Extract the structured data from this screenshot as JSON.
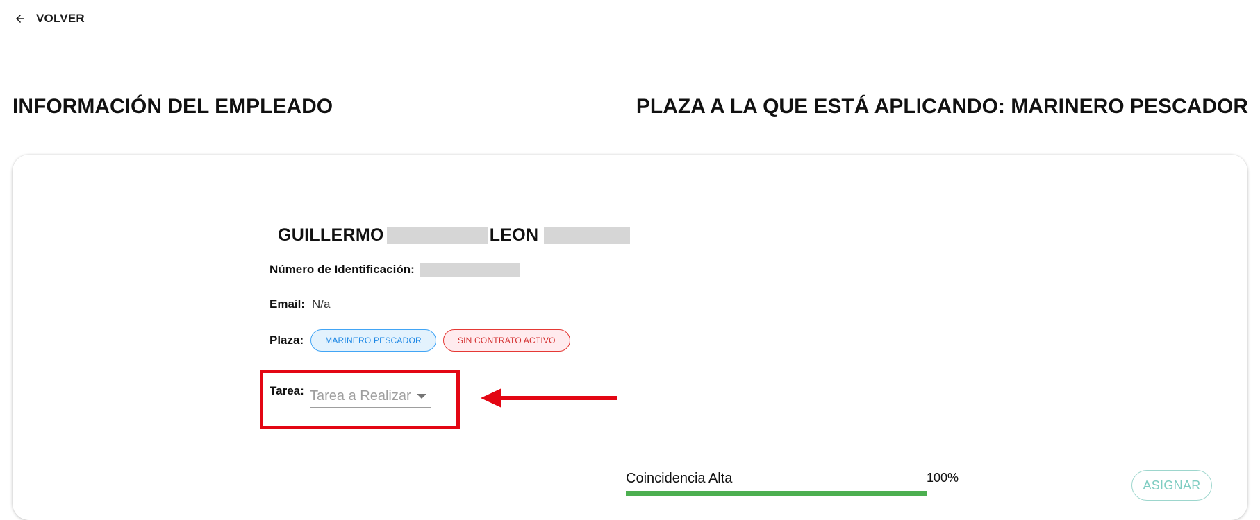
{
  "nav": {
    "back_label": "VOLVER",
    "back_icon": "arrow-left-icon"
  },
  "header": {
    "left_title": "INFORMACIÓN DEL EMPLEADO",
    "right_title": "PLAZA A LA QUE ESTÁ APLICANDO: MARINERO PESCADOR"
  },
  "employee": {
    "name_first": "GUILLERMO",
    "name_second": "LEON",
    "id_label": "Número de Identificación:",
    "email_label": "Email:",
    "email_value": "N/a",
    "plaza_label": "Plaza:",
    "chips": [
      {
        "label": "MARINERO PESCADOR",
        "color": "#1e88e5"
      },
      {
        "label": "SIN CONTRATO ACTIVO",
        "color": "#d32f2f"
      }
    ]
  },
  "task": {
    "label": "Tarea:",
    "placeholder": "Tarea a Realizar",
    "caret_icon": "caret-down-icon",
    "highlight_color": "#e30613"
  },
  "match": {
    "label": "Coincidencia Alta",
    "value_text": "100%",
    "percent": 100,
    "bar_color": "#4caf50"
  },
  "actions": {
    "assign_label": "ASIGNAR"
  }
}
